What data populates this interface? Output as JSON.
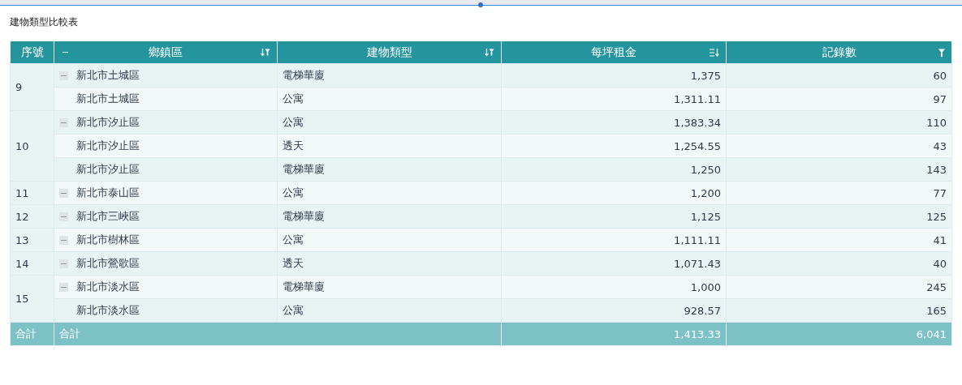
{
  "title": "建物類型比較表",
  "table": {
    "columns": [
      {
        "label": "序號",
        "kind": "plain"
      },
      {
        "label": "鄉鎮區",
        "kind": "sort-filter",
        "collapse": true
      },
      {
        "label": "建物類型",
        "kind": "sort-filter"
      },
      {
        "label": "每坪租金",
        "kind": "sort"
      },
      {
        "label": "記錄數",
        "kind": "filter"
      }
    ],
    "groups": [
      {
        "index": "9",
        "rows": [
          {
            "kind": "head",
            "district": "新北市土城區",
            "type": "電梯華廈",
            "rent": "1,375",
            "count": "60"
          },
          {
            "kind": "child",
            "district": "新北市土城區",
            "type": "公寓",
            "rent": "1,311.11",
            "count": "97"
          }
        ]
      },
      {
        "index": "10",
        "rows": [
          {
            "kind": "head",
            "district": "新北市汐止區",
            "type": "公寓",
            "rent": "1,383.34",
            "count": "110"
          },
          {
            "kind": "child",
            "district": "新北市汐止區",
            "type": "透天",
            "rent": "1,254.55",
            "count": "43"
          },
          {
            "kind": "child",
            "district": "新北市汐止區",
            "type": "電梯華廈",
            "rent": "1,250",
            "count": "143"
          }
        ]
      },
      {
        "index": "11",
        "rows": [
          {
            "kind": "head",
            "district": "新北市泰山區",
            "type": "公寓",
            "rent": "1,200",
            "count": "77"
          }
        ]
      },
      {
        "index": "12",
        "rows": [
          {
            "kind": "head",
            "district": "新北市三峽區",
            "type": "電梯華廈",
            "rent": "1,125",
            "count": "125"
          }
        ]
      },
      {
        "index": "13",
        "rows": [
          {
            "kind": "head",
            "district": "新北市樹林區",
            "type": "公寓",
            "rent": "1,111.11",
            "count": "41"
          }
        ]
      },
      {
        "index": "14",
        "rows": [
          {
            "kind": "head",
            "district": "新北市鶯歌區",
            "type": "透天",
            "rent": "1,071.43",
            "count": "40"
          }
        ]
      },
      {
        "index": "15",
        "rows": [
          {
            "kind": "head",
            "district": "新北市淡水區",
            "type": "電梯華廈",
            "rent": "1,000",
            "count": "245"
          },
          {
            "kind": "child",
            "district": "新北市淡水區",
            "type": "公寓",
            "rent": "928.57",
            "count": "165"
          }
        ]
      }
    ],
    "total": {
      "index": "合計",
      "label": "合計",
      "rent": "1,413.33",
      "count": "6,041"
    }
  }
}
